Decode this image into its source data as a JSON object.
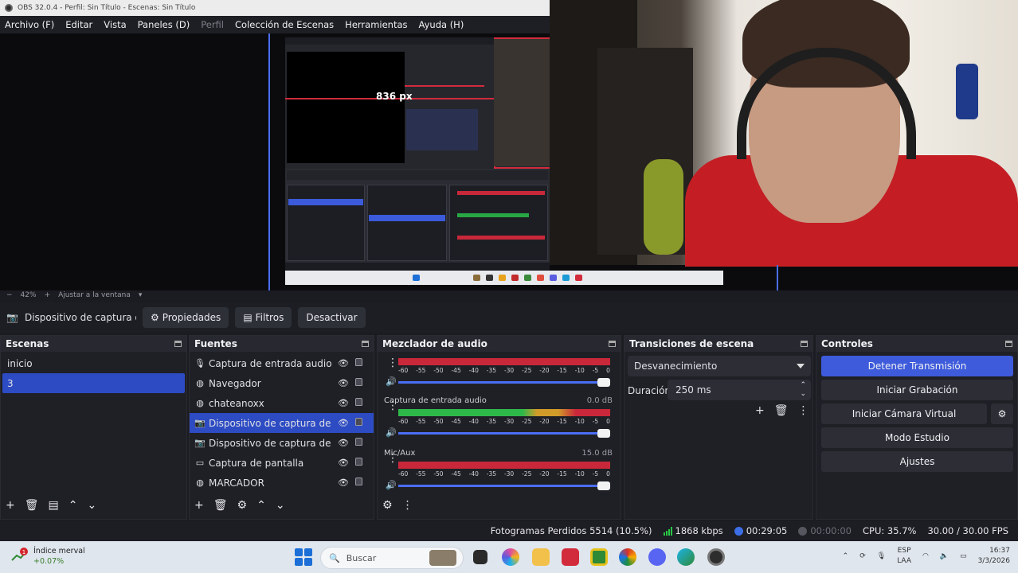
{
  "window": {
    "title": "OBS 32.0.4 - Perfil: Sin Título - Escenas: Sin Título"
  },
  "menu": [
    {
      "label": "Archivo (F)",
      "disabled": false
    },
    {
      "label": "Editar",
      "disabled": false
    },
    {
      "label": "Vista",
      "disabled": false
    },
    {
      "label": "Paneles (D)",
      "disabled": false
    },
    {
      "label": "Perfil",
      "disabled": true
    },
    {
      "label": "Colección de Escenas",
      "disabled": false
    },
    {
      "label": "Herramientas",
      "disabled": false
    },
    {
      "label": "Ayuda (H)",
      "disabled": false
    }
  ],
  "preview": {
    "zoom_minus": "−",
    "zoom_level": "42%",
    "zoom_plus": "+",
    "zoom_mode": "Ajustar a la ventana",
    "measure_label": "836 px"
  },
  "source_toolbar": {
    "source_name": "Dispositivo de captura de v",
    "properties_label": "Propiedades",
    "filters_label": "Filtros",
    "deactivate_label": "Desactivar"
  },
  "scenes": {
    "title": "Escenas",
    "items": [
      {
        "label": "inicio",
        "selected": false
      },
      {
        "label": "3",
        "selected": true
      }
    ]
  },
  "sources": {
    "title": "Fuentes",
    "items": [
      {
        "label": "Captura de entrada audio",
        "icon": "microphone-icon",
        "selected": false
      },
      {
        "label": "Navegador",
        "icon": "globe-icon",
        "selected": false
      },
      {
        "label": "chateanoxx",
        "icon": "globe-icon",
        "selected": false
      },
      {
        "label": "Dispositivo de captura de video",
        "icon": "camera-icon",
        "selected": true
      },
      {
        "label": "Dispositivo de captura de video",
        "icon": "camera-icon",
        "selected": false
      },
      {
        "label": "Captura de pantalla",
        "icon": "monitor-icon",
        "selected": false
      },
      {
        "label": "MARCADOR",
        "icon": "globe-icon",
        "selected": false
      }
    ]
  },
  "mixer": {
    "title": "Mezclador de audio",
    "ticks": [
      "-60",
      "-55",
      "-50",
      "-45",
      "-40",
      "-35",
      "-30",
      "-25",
      "-20",
      "-15",
      "-10",
      "-5",
      "0"
    ],
    "channels": [
      {
        "name": "",
        "db": "",
        "level": 0.0,
        "color": "#c8283a"
      },
      {
        "name": "Captura de entrada audio",
        "db": "0.0 dB",
        "level": 0.84,
        "color": "#2fb84a"
      },
      {
        "name": "Mic/Aux",
        "db": "15.0 dB",
        "level": 0.0,
        "color": "#c8283a"
      }
    ]
  },
  "transitions": {
    "title": "Transiciones de escena",
    "selected": "Desvanecimiento",
    "duration_label": "Duración",
    "duration_value": "250 ms"
  },
  "controls": {
    "title": "Controles",
    "buttons": [
      {
        "label": "Detener Transmisión",
        "primary": true
      },
      {
        "label": "Iniciar Grabación",
        "primary": false
      },
      {
        "label": "Iniciar Cámara Virtual",
        "primary": false
      },
      {
        "label": "Modo Estudio",
        "primary": false
      },
      {
        "label": "Ajustes",
        "primary": false
      }
    ]
  },
  "status": {
    "dropped_frames": "Fotogramas Perdidos 5514 (10.5%)",
    "bitrate": "1868 kbps",
    "stream_time": "00:29:05",
    "record_time": "00:00:00",
    "cpu": "CPU: 35.7%",
    "fps": "30.00 / 30.00 FPS"
  },
  "taskbar": {
    "weather_title": "Índice merval",
    "weather_value": "+0.07%",
    "weather_badge": "1",
    "search_placeholder": "Buscar",
    "lang_line1": "ESP",
    "lang_line2": "LAA",
    "time": "16:37",
    "date": "3/3/2026"
  },
  "colors": {
    "accent": "#3d5bdb",
    "red_meter": "#c8283a",
    "green_meter": "#2fb84a"
  }
}
